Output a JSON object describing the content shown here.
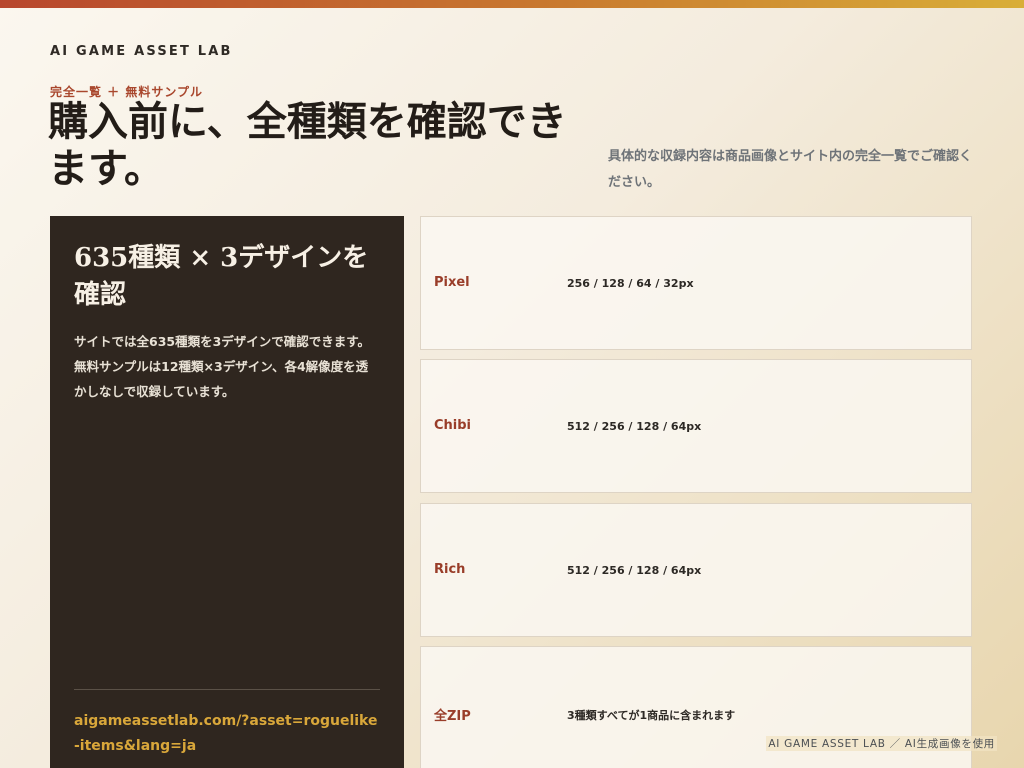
{
  "brand": "AI GAME ASSET LAB",
  "hero": {
    "eyebrow": "完全一覧 ＋ 無料サンプル",
    "headline": "購入前に、全種類を確認できます。",
    "lead": "具体的な収録内容は商品画像とサイト内の完全一覧でご確認ください。"
  },
  "summary_card": {
    "title": "635種類 × 3デザインを確認",
    "body": "サイトでは全635種類を3デザインで確認できます。無料サンプルは12種類×3デザイン、各4解像度を透かしなしで収録しています。",
    "link": "aigameassetlab.com/?asset=roguelike-items&lang=ja"
  },
  "specs": [
    {
      "name": "Pixel",
      "value": "256 / 128 / 64 / 32px"
    },
    {
      "name": "Chibi",
      "value": "512 / 256 / 128 / 64px"
    },
    {
      "name": "Rich",
      "value": "512 / 256 / 128 / 64px"
    },
    {
      "name": "全ZIP",
      "value": "3種類すべてが1商品に含まれます"
    }
  ],
  "footer": "AI GAME ASSET LAB ／ AI生成画像を使用",
  "colors": {
    "accent": "#993d29",
    "link": "#d9a73a",
    "dark_panel": "#2f261f"
  }
}
